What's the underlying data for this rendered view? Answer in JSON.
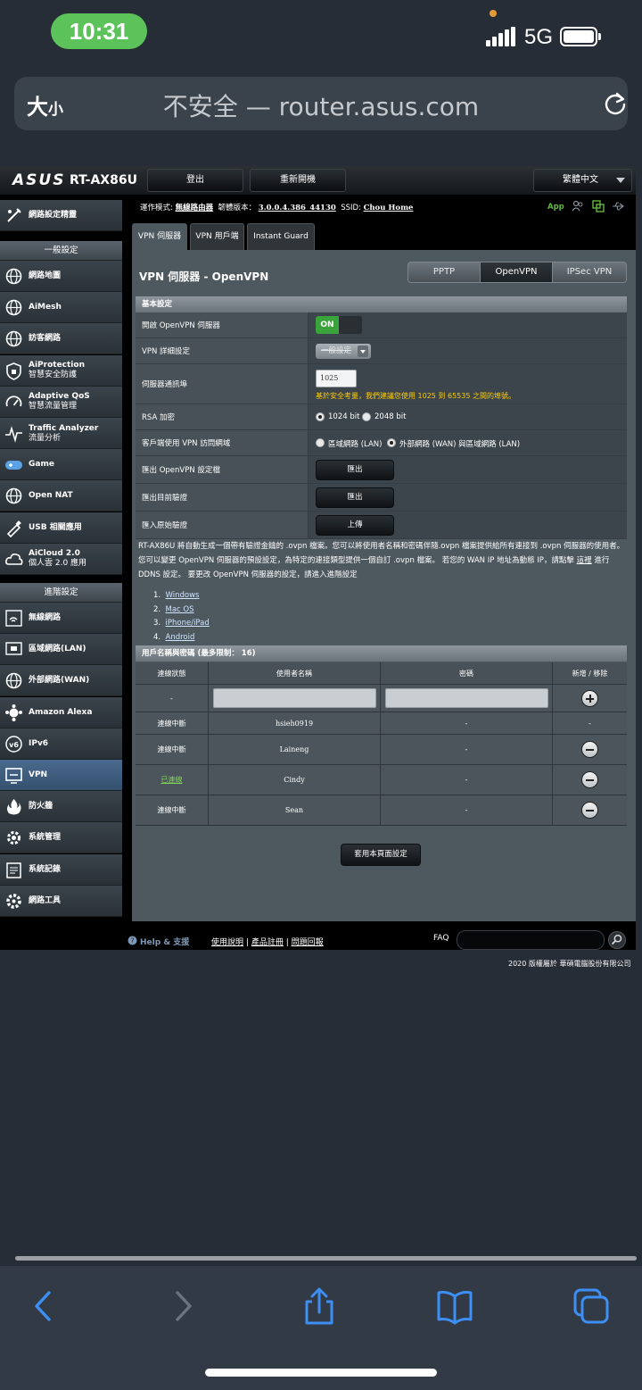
{
  "status_bar": {
    "time": "10:31",
    "network": "5G"
  },
  "browser": {
    "size_label_big": "大",
    "size_label_small": "小",
    "url": "不安全 — router.asus.com"
  },
  "router": {
    "brand": "ASUS",
    "model": "RT-AX86U",
    "logout": "登出",
    "reboot": "重新開機",
    "language": "繁體中文",
    "info": {
      "mode_label": "運作模式:",
      "mode_value": "無線路由器",
      "firmware_label": "韌體版本：",
      "firmware_value": "3.0.0.4.386_44130",
      "ssid_label": "SSID:",
      "ssid_value": "Chou Home",
      "app": "App"
    },
    "nav": {
      "quick_setup": "網路設定精靈",
      "general_header": "一般設定",
      "general": [
        {
          "label": "網路地圖",
          "icon": "globe-icon"
        },
        {
          "label": "AiMesh",
          "icon": "mesh-icon"
        },
        {
          "label": "訪客網路",
          "icon": "guest-globe-icon"
        },
        {
          "label": "AiProtection",
          "sub": "智慧安全防護",
          "icon": "shield-icon"
        },
        {
          "label": "Adaptive QoS",
          "sub": "智慧流量管理",
          "icon": "speedometer-icon"
        },
        {
          "label": "Traffic Analyzer",
          "sub": "流量分析",
          "icon": "pulse-icon"
        },
        {
          "label": "Game",
          "icon": "gamepad-icon"
        },
        {
          "label": "Open NAT",
          "icon": "nat-globe-icon"
        },
        {
          "label": "USB 相關應用",
          "icon": "usb-icon"
        },
        {
          "label": "AiCloud 2.0",
          "sub": "個人雲 2.0 應用",
          "icon": "cloud-icon"
        }
      ],
      "advanced_header": "進階設定",
      "advanced": [
        {
          "label": "無線網路",
          "icon": "wifi-icon"
        },
        {
          "label": "區域網路(LAN)",
          "icon": "lan-icon"
        },
        {
          "label": "外部網路(WAN)",
          "icon": "wan-globe-icon"
        },
        {
          "label": "Amazon Alexa",
          "icon": "alexa-icon"
        },
        {
          "label": "IPv6",
          "icon": "ipv6-icon"
        },
        {
          "label": "VPN",
          "icon": "vpn-icon",
          "active": true
        },
        {
          "label": "防火牆",
          "icon": "firewall-icon"
        },
        {
          "label": "系統管理",
          "icon": "admin-gear-icon"
        },
        {
          "label": "系統記錄",
          "icon": "log-icon"
        },
        {
          "label": "網路工具",
          "icon": "tools-gear-icon"
        }
      ]
    },
    "tabs": [
      "VPN 伺服器",
      "VPN 用戶端",
      "Instant Guard"
    ],
    "page_title": "VPN 伺服器 - OpenVPN",
    "protocols": [
      "PPTP",
      "OpenVPN",
      "IPSec VPN"
    ],
    "basic": {
      "header": "基本設定",
      "enable_label": "開啟 OpenVPN 伺服器",
      "enable_value": "ON",
      "detail_label": "VPN 詳細設定",
      "detail_value": "一般設定",
      "port_label": "伺服器通訊埠",
      "port_value": "1025",
      "port_hint": "基於安全考量，我們建議您使用 1025 到 65535 之間的埠號。",
      "rsa_label": "RSA 加密",
      "rsa_1024": "1024 bit",
      "rsa_2048": "2048 bit",
      "access_label": "客戶端使用 VPN 訪問網域",
      "access_lan": "區域網路 (LAN)",
      "access_wan": "外部網路 (WAN) 與區域網路 (LAN)",
      "export_label": "匯出 OpenVPN 設定檔",
      "export_btn": "匯出",
      "export_cert_label": "匯出目前驗證",
      "export_cert_btn": "匯出",
      "import_label": "匯入原始驗證",
      "import_btn": "上傳"
    },
    "description": {
      "part1": "RT-AX86U 將自動生成一個帶有驗證金鑰的 .ovpn 檔案。您可以將使用者名稱和密碼伴隨.ovpn 檔案提供給所有連接到 .ovpn 伺服器的使用者。 您可以變更 OpenVPN 伺服器的預設設定，為特定的連接類型提供一個自訂 .ovpn 檔案。 若您的 WAN IP 地址為動態 IP，請點擊 ",
      "link": "這裡",
      "part2": " 進行 DDNS 設定。 要更改 OpenVPN 伺服器的設定，請進入進階設定"
    },
    "platforms": [
      "Windows",
      "Mac OS",
      "iPhone/iPad",
      "Android"
    ],
    "users": {
      "header": "用戶名稱與密碼 (最多限制： 16)",
      "columns": [
        "連線狀態",
        "使用者名稱",
        "密碼",
        "新增 / 移除"
      ],
      "add_row_status": "-",
      "rows": [
        {
          "status": "連線中斷",
          "name": "hsieh0919",
          "password": "-",
          "action": "-"
        },
        {
          "status": "連線中斷",
          "name": "Laineng",
          "password": "-",
          "action": "remove"
        },
        {
          "status": "已連線",
          "name": "Cindy",
          "password": "-",
          "action": "remove"
        },
        {
          "status": "連線中斷",
          "name": "Sean",
          "password": "-",
          "action": "remove"
        }
      ]
    },
    "apply_btn": "套用本頁面設定",
    "footer": {
      "help": "Help & 支援",
      "manual": "使用說明",
      "sep": "|",
      "register": "產品註冊",
      "feedback": "問題回報",
      "faq": "FAQ"
    },
    "copyright": "2020 版權屬於 華碩電腦股份有限公司"
  },
  "colors": {
    "accent_green": "#5cc35a",
    "link_green": "#7ed357",
    "hint_yellow": "#ffcc00",
    "active_nav": "#4a6a8d"
  }
}
